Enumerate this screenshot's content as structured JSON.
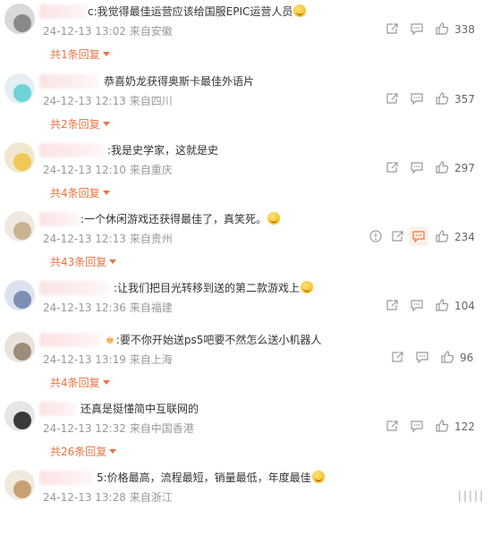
{
  "comments": [
    {
      "text": "c:我觉得最佳运营应该给国服EPIC运营人员",
      "emoji": true,
      "crown": false,
      "time": "24-12-13 13:02",
      "location": "来自安徽",
      "replies": "共1条回复",
      "likes": "338",
      "report": false
    },
    {
      "text": "恭喜奶龙获得奥斯卡最佳外语片",
      "emoji": false,
      "crown": false,
      "time": "24-12-13 12:13",
      "location": "来自四川",
      "replies": "共2条回复",
      "likes": "357",
      "report": false
    },
    {
      "text": ":我是史学家，这就是史",
      "emoji": false,
      "crown": false,
      "time": "24-12-13 12:10",
      "location": "来自重庆",
      "replies": "共4条回复",
      "likes": "297",
      "report": false
    },
    {
      "text": ":一个休闲游戏还获得最佳了，真笑死。",
      "emoji": true,
      "crown": false,
      "time": "24-12-13 12:13",
      "location": "来自贵州",
      "replies": "共43条回复",
      "likes": "234",
      "report": true
    },
    {
      "text": ":让我们把目光转移到送的第二款游戏上",
      "emoji": true,
      "crown": false,
      "time": "24-12-13 12:36",
      "location": "来自福建",
      "replies": "",
      "likes": "104",
      "report": false
    },
    {
      "text": ":要不你开始送ps5吧要不然怎么送小机器人",
      "emoji": false,
      "crown": true,
      "time": "24-12-13 13:19",
      "location": "来自上海",
      "replies": "共4条回复",
      "likes": "96",
      "report": false
    },
    {
      "text": "还真是挺懂简中互联网的",
      "emoji": false,
      "crown": false,
      "time": "24-12-13 12:32",
      "location": "来自中国香港",
      "replies": "共26条回复",
      "likes": "122",
      "report": false
    },
    {
      "text": "5:价格最高，流程最短，销量最低，年度最佳",
      "emoji": true,
      "crown": false,
      "time": "24-12-13 13:28",
      "location": "来自浙江",
      "replies": "",
      "likes": "",
      "report": false
    }
  ],
  "icons": {
    "share": "share-icon",
    "comment": "comment-icon",
    "like": "like-icon",
    "report": "report-icon"
  },
  "colors": {
    "accent": "#eb7340",
    "meta": "#999999",
    "text": "#333333"
  },
  "watermark": "|||||"
}
